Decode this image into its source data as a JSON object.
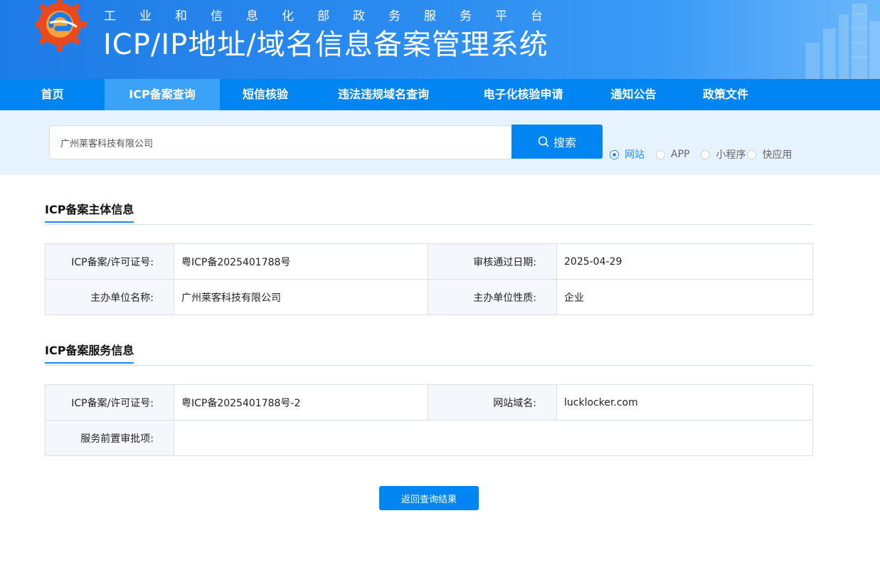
{
  "header": {
    "subtitle": "工业和信息化部政务服务平台",
    "title": "ICP/IP地址/域名信息备案管理系统",
    "colors": {
      "nav": "#0085f2",
      "nav_active": "#3aa3f7",
      "band": "#e6f2fd"
    }
  },
  "nav": {
    "items": [
      {
        "label": "首页"
      },
      {
        "label": "ICP备案查询"
      },
      {
        "label": "短信核验"
      },
      {
        "label": "违法违规域名查询"
      },
      {
        "label": "电子化核验申请"
      },
      {
        "label": "通知公告"
      },
      {
        "label": "政策文件"
      }
    ],
    "active": "ICP备案查询"
  },
  "search": {
    "value": "广州莱客科技有限公司",
    "button_label": "搜索",
    "button_icon": "search-icon",
    "types": [
      {
        "label": "网站",
        "checked": true
      },
      {
        "label": "APP",
        "checked": false
      },
      {
        "label": "小程序",
        "checked": false
      },
      {
        "label": "快应用",
        "checked": false
      }
    ]
  },
  "subject": {
    "title": "ICP备案主体信息",
    "license_label": "ICP备案/许可证号:",
    "license_value": "粤ICP备2025401788号",
    "date_label": "审核通过日期:",
    "date_value": "2025-04-29",
    "org_label": "主办单位名称:",
    "org_value": "广州莱客科技有限公司",
    "nature_label": "主办单位性质:",
    "nature_value": "企业"
  },
  "service": {
    "title": "ICP备案服务信息",
    "license_label": "ICP备案/许可证号:",
    "license_value": "粤ICP备2025401788号-2",
    "domain_label": "网站域名:",
    "domain_value": "lucklocker.com",
    "approval_label": "服务前置审批项:",
    "approval_value": ""
  },
  "back_button": "返回查询结果"
}
